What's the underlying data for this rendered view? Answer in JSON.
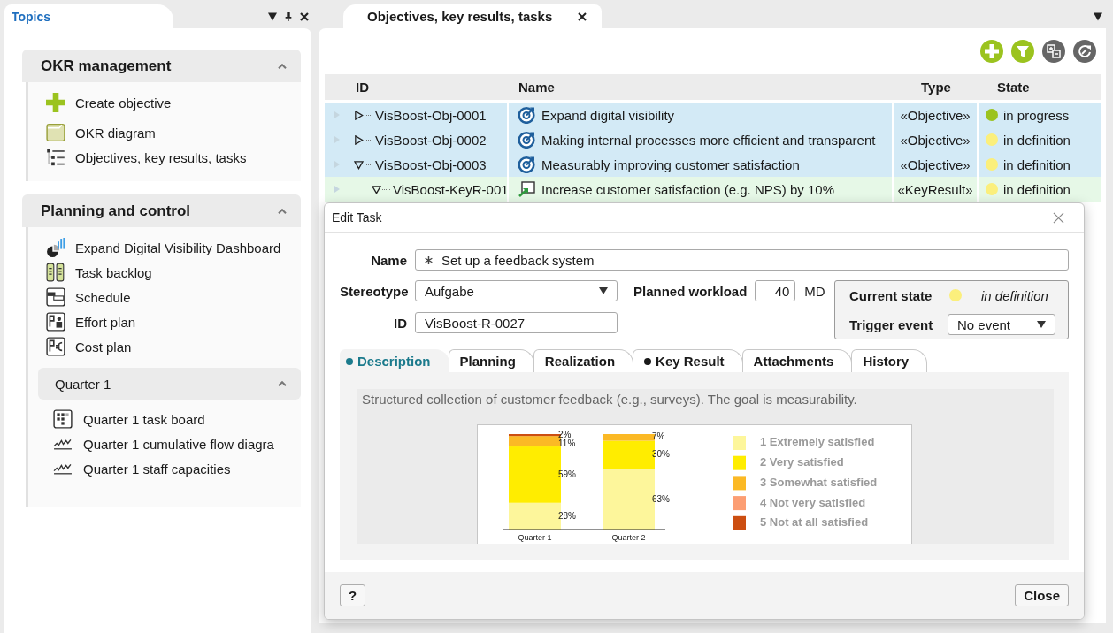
{
  "topics": {
    "title": "Topics",
    "sections": [
      {
        "title": "OKR management",
        "expanded": true,
        "items": [
          {
            "label": "Create objective",
            "kind": "action"
          },
          {
            "label": "OKR diagram",
            "kind": "diagram"
          },
          {
            "label": "Objectives, key results, tasks",
            "kind": "list"
          }
        ]
      },
      {
        "title": "Planning and control",
        "expanded": true,
        "items": [
          {
            "label": "Expand Digital Visibility Dashboard",
            "kind": "dashboard"
          },
          {
            "label": "Task backlog",
            "kind": "backlog"
          },
          {
            "label": "Schedule",
            "kind": "schedule"
          },
          {
            "label": "Effort plan",
            "kind": "effort"
          },
          {
            "label": "Cost plan",
            "kind": "cost"
          }
        ],
        "subsections": [
          {
            "title": "Quarter 1",
            "expanded": true,
            "items": [
              {
                "label": "Quarter 1 task board",
                "kind": "board"
              },
              {
                "label": "Quarter 1 cumulative flow diagra",
                "kind": "linechart"
              },
              {
                "label": "Quarter 1 staff capacities",
                "kind": "linechart"
              }
            ]
          }
        ]
      }
    ]
  },
  "document_tabs": [
    {
      "label": "Objectives, key results, tasks",
      "selected": true
    }
  ],
  "table": {
    "columns": [
      "ID",
      "Name",
      "Type",
      "State"
    ],
    "rows": [
      {
        "kind": "objective",
        "id": "VisBoost-Obj-0001",
        "name": "Expand digital visibility",
        "type": "«Objective»",
        "state": "in progress",
        "color": "#9bc31f",
        "expanded": false
      },
      {
        "kind": "objective",
        "id": "VisBoost-Obj-0002",
        "name": "Making internal processes more efficient and transparent",
        "type": "«Objective»",
        "state": "in definition",
        "color": "#fbef7c",
        "expanded": false
      },
      {
        "kind": "objective",
        "id": "VisBoost-Obj-0003",
        "name": "Measurably improving customer satisfaction",
        "type": "«Objective»",
        "state": "in definition",
        "color": "#fbef7c",
        "expanded": true,
        "children": [
          {
            "kind": "keyresult",
            "id": "VisBoost-KeyR-001",
            "name": "Increase customer satisfaction (e.g. NPS) by 10%",
            "type": "«KeyResult»",
            "state": "in definition",
            "color": "#fbef7c",
            "expanded": true
          }
        ]
      }
    ]
  },
  "dialog": {
    "title": "Edit Task",
    "name": {
      "label": "Name",
      "value": "Set up a feedback system",
      "required": true
    },
    "stereotype": {
      "label": "Stereotype",
      "value": "Aufgabe"
    },
    "planned_workload": {
      "label": "Planned workload",
      "value": "40",
      "unit": "MD"
    },
    "id": {
      "label": "ID",
      "value": "VisBoost-R-0027"
    },
    "current_state": {
      "label": "Current state",
      "value": "in definition",
      "color": "#fbef7c"
    },
    "trigger_event": {
      "label": "Trigger event",
      "value": "No event"
    },
    "tabs": [
      {
        "label": "Description",
        "selected": true,
        "marked": true
      },
      {
        "label": "Planning",
        "selected": false,
        "marked": false
      },
      {
        "label": "Realization",
        "selected": false,
        "marked": false
      },
      {
        "label": "Key Result",
        "selected": false,
        "marked": true
      },
      {
        "label": "Attachments",
        "selected": false,
        "marked": false
      },
      {
        "label": "History",
        "selected": false,
        "marked": false
      }
    ],
    "description": "Structured collection of customer feedback (e.g., surveys). The goal is measurability.",
    "chart_data": {
      "type": "bar",
      "stacked": true,
      "categories": [
        "Quarter 1",
        "Quarter 2"
      ],
      "series": [
        {
          "name": "1 Extremely satisfied",
          "color": "#fdf69b",
          "values": [
            28,
            63
          ],
          "value_labels": [
            "28%",
            "63%"
          ]
        },
        {
          "name": "2 Very satisfied",
          "color": "#ffed00",
          "values": [
            59,
            30
          ],
          "value_labels": [
            "59%",
            "30%"
          ]
        },
        {
          "name": "3 Somewhat satisfied",
          "color": "#fbb925",
          "values": [
            11,
            7
          ],
          "value_labels": [
            "11%",
            "7%"
          ]
        },
        {
          "name": "4 Not very satisfied",
          "color": "#fc9e73",
          "values": [
            null,
            null
          ],
          "value_labels": [
            null,
            null
          ]
        },
        {
          "name": "5 Not at all satisfied",
          "color": "#cc4e11",
          "values": [
            2,
            null
          ],
          "value_labels": [
            "2%",
            null
          ]
        }
      ],
      "legend": "right"
    },
    "buttons": [
      "?",
      "Close"
    ]
  }
}
